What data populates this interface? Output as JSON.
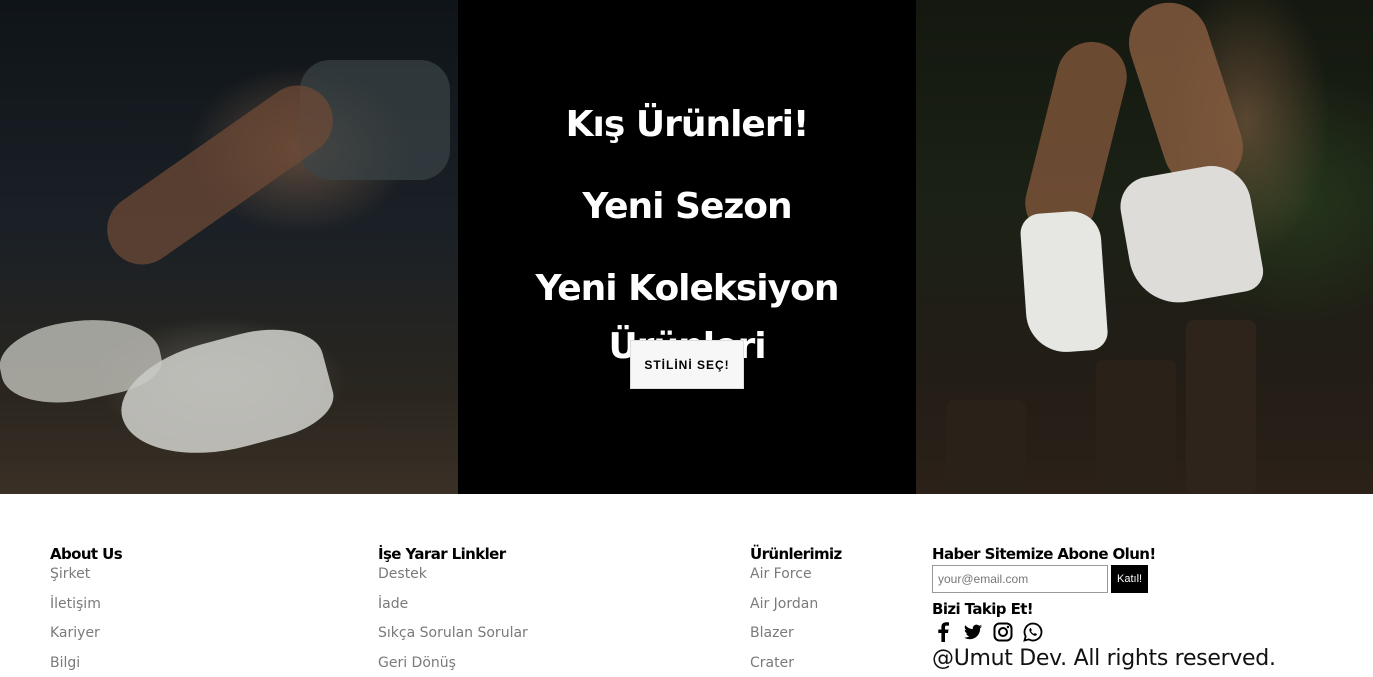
{
  "hero": {
    "line1": "Kış Ürünleri!",
    "line2": "Yeni Sezon",
    "line3": "Yeni Koleksiyon Ürünleri",
    "button_label": "STİLİNİ SEÇ!"
  },
  "footer": {
    "about": {
      "title": "About Us",
      "items": [
        "Şirket",
        "İletişim",
        "Kariyer",
        "Bilgi"
      ]
    },
    "links": {
      "title": "İşe Yarar Linkler",
      "items": [
        "Destek",
        "İade",
        "Sıkça Sorulan Sorular",
        "Geri Dönüş"
      ]
    },
    "products": {
      "title": "Ürünlerimiz",
      "items": [
        "Air Force",
        "Air Jordan",
        "Blazer",
        "Crater"
      ]
    },
    "newsletter": {
      "title": "Haber Sitemize Abone Olun!",
      "placeholder": "your@email.com",
      "button_label": "Katıl!"
    },
    "follow": {
      "title": "Bizi Takip Et!",
      "icons": [
        "facebook-icon",
        "twitter-icon",
        "instagram-icon",
        "whatsapp-icon"
      ]
    },
    "rights": "@Umut Dev. All rights reserved."
  }
}
